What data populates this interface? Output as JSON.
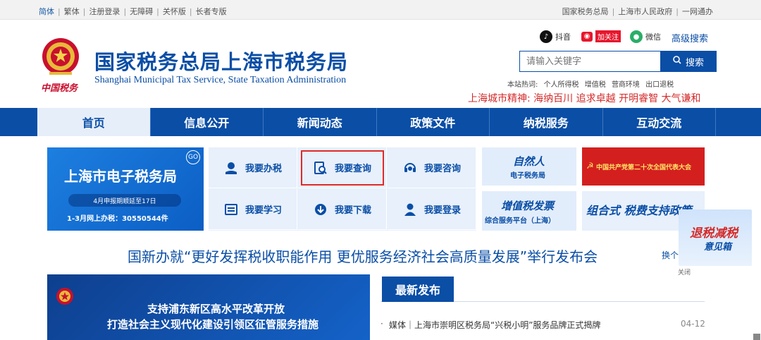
{
  "topbar": {
    "links": [
      {
        "label": "简体",
        "active": true
      },
      {
        "label": "繁体"
      },
      {
        "label": "注册登录"
      },
      {
        "label": "无障碍"
      },
      {
        "label": "关怀版"
      },
      {
        "label": "长者专版"
      }
    ],
    "right_links": [
      "国家税务总局",
      "上海市人民政府",
      "一网通办"
    ]
  },
  "header": {
    "title": "国家税务总局上海市税务局",
    "subtitle": "Shanghai Municipal Tax Service, State Taxation Administration",
    "emblem_text": "中国税务"
  },
  "social": {
    "douyin": "抖音",
    "weibo": "加关注",
    "wechat": "微信",
    "advanced_search": "高级搜索"
  },
  "search": {
    "placeholder": "请输入关键字",
    "button": "搜索",
    "hot_label": "本站热词:",
    "hot_words": [
      "个人所得税",
      "增值税",
      "营商环境",
      "出口退税"
    ]
  },
  "spirit": "上海城市精神:  海纳百川 追求卓越 开明睿智 大气谦和",
  "nav": [
    "首页",
    "信息公开",
    "新闻动态",
    "政策文件",
    "纳税服务",
    "互动交流"
  ],
  "etax": {
    "title": "上海市电子税务局",
    "go": "GO",
    "notice": "4月申报期顺延至17日",
    "count": "1-3月网上办税：30550544件"
  },
  "services": [
    {
      "label": "我要办税",
      "icon": "hand-coin-icon"
    },
    {
      "label": "我要查询",
      "icon": "doc-search-icon"
    },
    {
      "label": "我要咨询",
      "icon": "headset-icon"
    },
    {
      "label": "我要学习",
      "icon": "book-icon"
    },
    {
      "label": "我要下载",
      "icon": "download-icon"
    },
    {
      "label": "我要登录",
      "icon": "user-icon"
    }
  ],
  "tiles": {
    "natural_person_1": "自然人",
    "natural_person_2": "电子税务局",
    "party_congress": "中国共产党第二十次全国代表大会",
    "vat_1": "增值税发票",
    "vat_2": "综合服务平台（上海）",
    "combo": "组合式 税费支持政策"
  },
  "float_ad": {
    "line1": "退税减税",
    "line2": "意见箱",
    "close": "关闭"
  },
  "headline": "国新办就“更好发挥税收职能作用 更优服务经济社会高质量发展”举行发布会",
  "switch": "换个",
  "banner": {
    "line1": "支持浦东新区高水平改革开放",
    "line2": "打造社会主义现代化建设引领区征管服务措施"
  },
  "latest": {
    "tab": "最新发布",
    "items": [
      {
        "title": "媒体｜上海市崇明区税务局“兴税小明”服务品牌正式揭牌",
        "date": "04-12"
      }
    ]
  },
  "colors": {
    "brand": "#0a4ea6",
    "red": "#d42a2a"
  }
}
